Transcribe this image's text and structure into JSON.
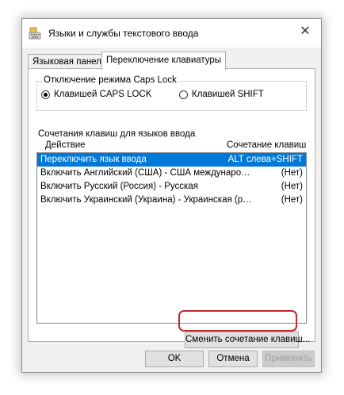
{
  "window": {
    "title": "Языки и службы текстового ввода",
    "close_glyph": "✕"
  },
  "tabs": [
    {
      "label": "Языковая панель",
      "active": false
    },
    {
      "label": "Переключение клавиатуры",
      "active": true
    }
  ],
  "caps_group": {
    "legend": "Отключение режима Caps Lock",
    "options": [
      {
        "label": "Клавишей CAPS LOCK",
        "checked": true
      },
      {
        "label": "Клавишей SHIFT",
        "checked": false
      }
    ]
  },
  "hotkeys_group": {
    "legend": "Сочетания клавиш для языков ввода",
    "col_action": "Действие",
    "col_combo": "Сочетание клавиш",
    "rows": [
      {
        "action": "Переключить язык ввода",
        "combo": "ALT слева+SHIFT",
        "selected": true
      },
      {
        "action": "Включить Английский (США) - США международная",
        "combo": "(Нет)",
        "selected": false
      },
      {
        "action": "Включить Русский (Россия) - Русская",
        "combo": "(Нет)",
        "selected": false
      },
      {
        "action": "Включить Украинский (Украина) - Украинская (расширенная)",
        "combo": "(Нет)",
        "selected": false
      }
    ],
    "change_button": "Сменить сочетание клавиш..."
  },
  "footer": {
    "ok": "OK",
    "cancel": "Отмена",
    "apply": "Применить"
  },
  "colors": {
    "selection": "#0078d7",
    "highlight_ring": "#c0282c"
  }
}
